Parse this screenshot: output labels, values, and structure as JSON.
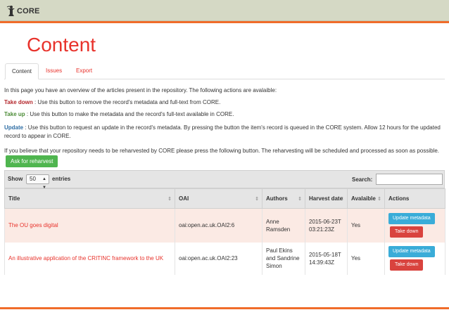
{
  "header": {
    "logo_text": "CORE"
  },
  "page": {
    "title": "Content"
  },
  "tabs": [
    {
      "label": "Content",
      "active": true
    },
    {
      "label": "Issues",
      "active": false
    },
    {
      "label": "Export",
      "active": false
    }
  ],
  "intro": "In this page you have an overview of the articles present in the repository. The following actions are avalaible:",
  "take_down": {
    "label": "Take down",
    "text": ": Use this button to remove the record's metadata and full-text from CORE."
  },
  "take_up": {
    "label": "Take up",
    "text": ": Use this button to make the metadata and the record's full-text available in CORE."
  },
  "update": {
    "label": "Update",
    "text": ": Use this button to request an update in the record's metadata. By pressing the button the item's record is queued in the CORE system. Allow 12 hours for the updated record to appear in CORE."
  },
  "reharvest": {
    "text": "If you believe that your repository needs to be reharvested by CORE please press the following button. The reharvesting will be scheduled and processed as soon as possible.",
    "button_label": "Ask for reharvest"
  },
  "table_controls": {
    "show_label": "Show",
    "show_value": "50",
    "entries_label": "entries",
    "search_label": "Search:",
    "search_value": ""
  },
  "table": {
    "columns": [
      "Title",
      "OAI",
      "Authors",
      "Harvest date",
      "Avalaible",
      "Actions"
    ],
    "rows": [
      {
        "title": "The OU goes digital",
        "oai": "oai:open.ac.uk.OAI2:6",
        "authors": "Anne Ramsden",
        "harvest_date": "2015-06-23T03:21:23Z",
        "available": "Yes",
        "update_label": "Update metadata",
        "take_label": "Take down"
      },
      {
        "title": "An illustrative application of the CRITINC framework to the UK",
        "oai": "oai:open.ac.uk.OAI2:23",
        "authors": "Paul Ekins and Sandrine Simon",
        "harvest_date": "2015-05-18T14:39:43Z",
        "available": "Yes",
        "update_label": "Update metadata",
        "take_label": "Take down"
      }
    ]
  },
  "colors": {
    "accent_red": "#e8322b",
    "orange_bar": "#f06c2a",
    "header_bg": "#d5d9c5",
    "update_button": "#3aacd8",
    "take_down_button": "#d9433e",
    "reharvest_button": "#4fb54f"
  },
  "icons": {
    "logo": "core-logo-icon",
    "sort": "sort-arrows-icon",
    "select_arrow": "select-updown-icon"
  }
}
